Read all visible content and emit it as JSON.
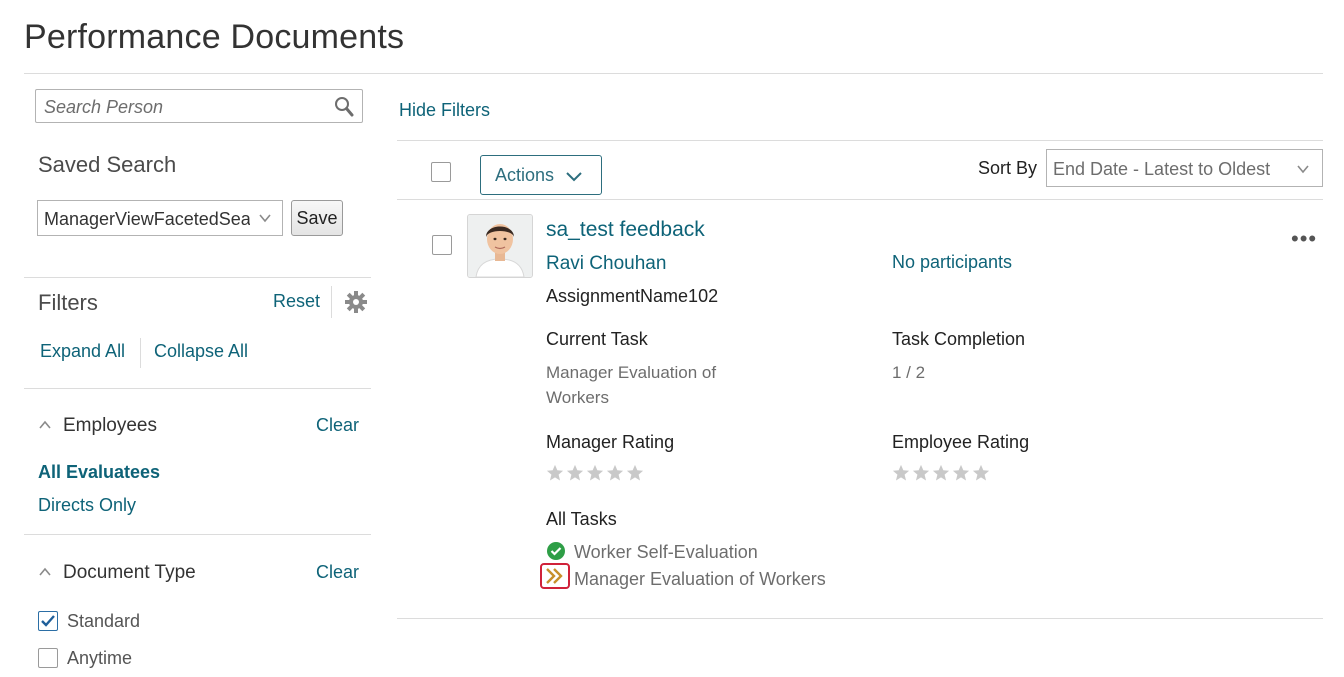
{
  "page": {
    "title": "Performance Documents"
  },
  "search": {
    "placeholder": "Search Person"
  },
  "saved_search": {
    "heading": "Saved Search",
    "selected": "ManagerViewFacetedSearch",
    "save_label": "Save"
  },
  "filters": {
    "heading": "Filters",
    "reset_label": "Reset",
    "expand_all": "Expand All",
    "collapse_all": "Collapse All",
    "employees": {
      "heading": "Employees",
      "clear_label": "Clear",
      "options": [
        "All Evaluatees",
        "Directs Only"
      ],
      "selected": "All Evaluatees"
    },
    "document_type": {
      "heading": "Document Type",
      "clear_label": "Clear",
      "options": [
        {
          "label": "Standard",
          "checked": true
        },
        {
          "label": "Anytime",
          "checked": false
        }
      ]
    }
  },
  "toolbar": {
    "hide_filters": "Hide Filters",
    "actions_label": "Actions",
    "sort_by_label": "Sort By",
    "sort_selected": "End Date - Latest to Oldest"
  },
  "document": {
    "title": "sa_test feedback",
    "person": "Ravi Chouhan",
    "assignment": "AssignmentName102",
    "participants": "No participants",
    "more_label": "•••",
    "current_task_label": "Current Task",
    "current_task_line1": "Manager Evaluation of",
    "current_task_line2": "Workers",
    "task_completion_label": "Task Completion",
    "task_completion": "1 / 2",
    "manager_rating_label": "Manager Rating",
    "manager_rating": 0,
    "employee_rating_label": "Employee Rating",
    "employee_rating": 0,
    "all_tasks_label": "All Tasks",
    "tasks": [
      {
        "name": "Worker Self-Evaluation",
        "status": "completed",
        "icon": "check-circle-icon"
      },
      {
        "name": "Manager Evaluation of Workers",
        "status": "in-progress",
        "icon": "double-chevron-right-icon"
      }
    ]
  },
  "colors": {
    "link": "#0e6378",
    "accent_button": "#2d6e7e",
    "success": "#2e9e46",
    "in_progress": "#c7902b",
    "highlight_box": "#d0223a",
    "star": "#c9c9c9"
  }
}
